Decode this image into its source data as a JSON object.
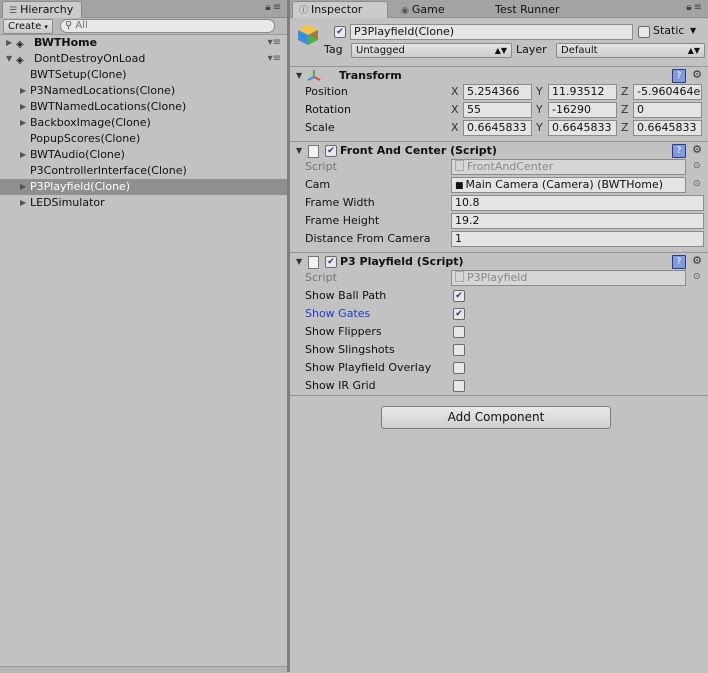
{
  "hierarchy": {
    "tab_label": "Hierarchy",
    "create_label": "Create",
    "search_placeholder": "All",
    "items": [
      {
        "label": "BWTHome",
        "level": 0,
        "arrow": "▶",
        "bold": true,
        "unity_icon": true,
        "menu": true
      },
      {
        "label": "DontDestroyOnLoad",
        "level": 0,
        "arrow": "▼",
        "bold": false,
        "unity_icon": true,
        "menu": true
      },
      {
        "label": "BWTSetup(Clone)",
        "level": 1,
        "arrow": "",
        "bold": false
      },
      {
        "label": "P3NamedLocations(Clone)",
        "level": 1,
        "arrow": "▶",
        "bold": false
      },
      {
        "label": "BWTNamedLocations(Clone)",
        "level": 1,
        "arrow": "▶",
        "bold": false
      },
      {
        "label": "BackboxImage(Clone)",
        "level": 1,
        "arrow": "▶",
        "bold": false
      },
      {
        "label": "PopupScores(Clone)",
        "level": 1,
        "arrow": "",
        "bold": false
      },
      {
        "label": "BWTAudio(Clone)",
        "level": 1,
        "arrow": "▶",
        "bold": false
      },
      {
        "label": "P3ControllerInterface(Clone)",
        "level": 1,
        "arrow": "",
        "bold": false
      },
      {
        "label": "P3Playfield(Clone)",
        "level": 1,
        "arrow": "▶",
        "bold": false,
        "selected": true
      },
      {
        "label": "LEDSimulator",
        "level": 1,
        "arrow": "▶",
        "bold": false
      }
    ]
  },
  "inspector": {
    "tabs": [
      "Inspector",
      "Game",
      "Test Runner"
    ],
    "object_name": "P3Playfield(Clone)",
    "static_label": "Static",
    "tag_label": "Tag",
    "tag_value": "Untagged",
    "layer_label": "Layer",
    "layer_value": "Default",
    "transform": {
      "title": "Transform",
      "rows": [
        {
          "label": "Position",
          "x": "5.254366",
          "y": "11.93512",
          "z": "-5.960464e"
        },
        {
          "label": "Rotation",
          "x": "55",
          "y": "-16290",
          "z": "0"
        },
        {
          "label": "Scale",
          "x": "0.6645833",
          "y": "0.6645833",
          "z": "0.6645833"
        }
      ],
      "axis_x": "X",
      "axis_y": "Y",
      "axis_z": "Z"
    },
    "front_and_center": {
      "title": "Front And Center (Script)",
      "script_label": "Script",
      "script_value": "FrontAndCenter",
      "cam_label": "Cam",
      "cam_value": "Main Camera (Camera) (BWTHome)",
      "frame_width_label": "Frame Width",
      "frame_width_value": "10.8",
      "frame_height_label": "Frame Height",
      "frame_height_value": "19.2",
      "distance_label": "Distance From Camera",
      "distance_value": "1"
    },
    "playfield": {
      "title": "P3 Playfield (Script)",
      "script_label": "Script",
      "script_value": "P3Playfield",
      "options": [
        {
          "label": "Show Ball Path",
          "checked": true
        },
        {
          "label": "Show Gates",
          "checked": true,
          "highlight": true
        },
        {
          "label": "Show Flippers",
          "checked": false
        },
        {
          "label": "Show Slingshots",
          "checked": false
        },
        {
          "label": "Show Playfield Overlay",
          "checked": false
        },
        {
          "label": "Show IR Grid",
          "checked": false
        }
      ]
    },
    "add_component_label": "Add Component"
  }
}
